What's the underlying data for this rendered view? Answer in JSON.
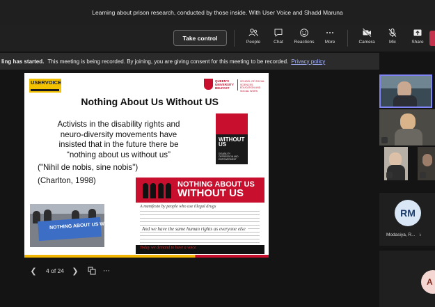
{
  "meeting": {
    "title": "Learning about prison research, conducted by those inside. With User Voice and Shadd Maruna"
  },
  "toolbar": {
    "take_control": "Take control",
    "items": [
      {
        "label": "People",
        "icon": "people-icon"
      },
      {
        "label": "Chat",
        "icon": "chat-icon"
      },
      {
        "label": "Reactions",
        "icon": "reactions-icon"
      },
      {
        "label": "More",
        "icon": "more-icon"
      },
      {
        "label": "Camera",
        "icon": "camera-off-icon"
      },
      {
        "label": "Mic",
        "icon": "mic-off-icon"
      },
      {
        "label": "Share",
        "icon": "share-icon"
      }
    ]
  },
  "banner": {
    "bold": "ling has started.",
    "text": "This meeting is being recorded. By joining, you are giving consent for this meeting to be recorded.",
    "link": "Privacy policy"
  },
  "slide": {
    "logo_left": "USERVOICE",
    "logo_right_line1": "QUEEN'S UNIVERSITY BELFAST",
    "logo_right_line2": "SCHOOL OF SOCIAL SCIENCES, EDUCATION AND SOCIAL WORK",
    "title": "Nothing About Us Without US",
    "body": "Activists in the disability rights and neuro-diversity movements have insisted that in the future there be “nothing about us without us”",
    "latin": "(\"Nihil de nobis, sine nobis\")",
    "citation": "(Charlton, 1998)",
    "book_cover_title": "WITHOUT US",
    "book_cover_subtitle": "DISABILITY OPPRESSION AND EMPOWERMENT",
    "manifesto_title_1": "NOTHING ABOUT US",
    "manifesto_title_2": "WITHOUT US",
    "manifesto_subtitle": "A manifesto by people who use illegal drugs",
    "manifesto_human_rights": "And we have the same human rights as everyone else",
    "manifesto_footer": "Today we demand to have a voice",
    "protest_banner": "NOTHING ABOUT US WITHOUT US"
  },
  "navigation": {
    "counter": "4 of 24"
  },
  "participants": {
    "rm_initials": "RM",
    "rm_name": "Modasiya, R...",
    "a_initial": "A"
  }
}
